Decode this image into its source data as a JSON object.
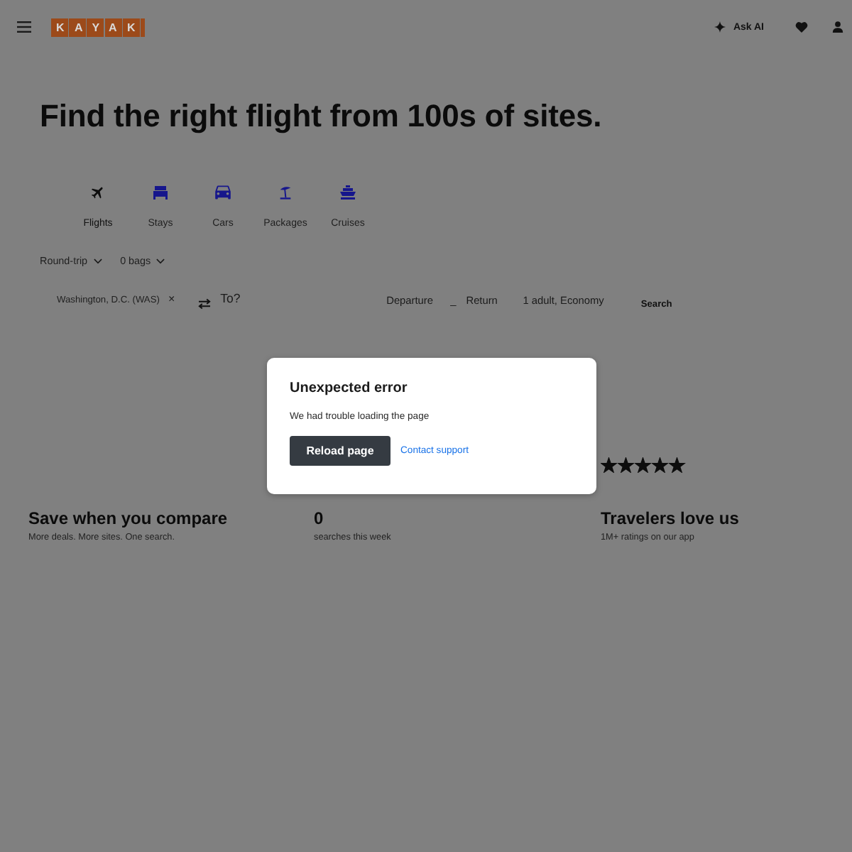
{
  "header": {
    "logo": "KAYAK",
    "ask_ai": "Ask AI"
  },
  "headline": "Find the right flight from 100s of sites.",
  "verticals": [
    {
      "kind": "flights",
      "label": "Flights",
      "selected": true
    },
    {
      "kind": "stays",
      "label": "Stays",
      "selected": false
    },
    {
      "kind": "cars",
      "label": "Cars",
      "selected": false
    },
    {
      "kind": "packages",
      "label": "Packages",
      "selected": false
    },
    {
      "kind": "cruises",
      "label": "Cruises",
      "selected": false
    }
  ],
  "trip_options": [
    {
      "label": "Round-trip"
    },
    {
      "label": "0 bags"
    }
  ],
  "search_form": {
    "origin": {
      "value": "Washington, D.C. (WAS)",
      "clear": "×"
    },
    "destination": {
      "placeholder": "To?"
    },
    "departure": {
      "placeholder": "Departure"
    },
    "date_separator": "_",
    "return": {
      "placeholder": "Return"
    },
    "travelers": "1 adult, Economy",
    "search_button": "Search"
  },
  "stats": [
    {
      "title": "Save when you compare",
      "subtitle": "More deals. More sites. One search."
    },
    {
      "title": "0",
      "subtitle": "searches this week"
    },
    {
      "stars": 5,
      "title": "Travelers love us",
      "subtitle": "1M+ ratings on our app"
    }
  ],
  "dialog": {
    "title": "Unexpected error",
    "message": "We had trouble loading the page",
    "primary_button": "Reload page",
    "link": "Contact support"
  }
}
